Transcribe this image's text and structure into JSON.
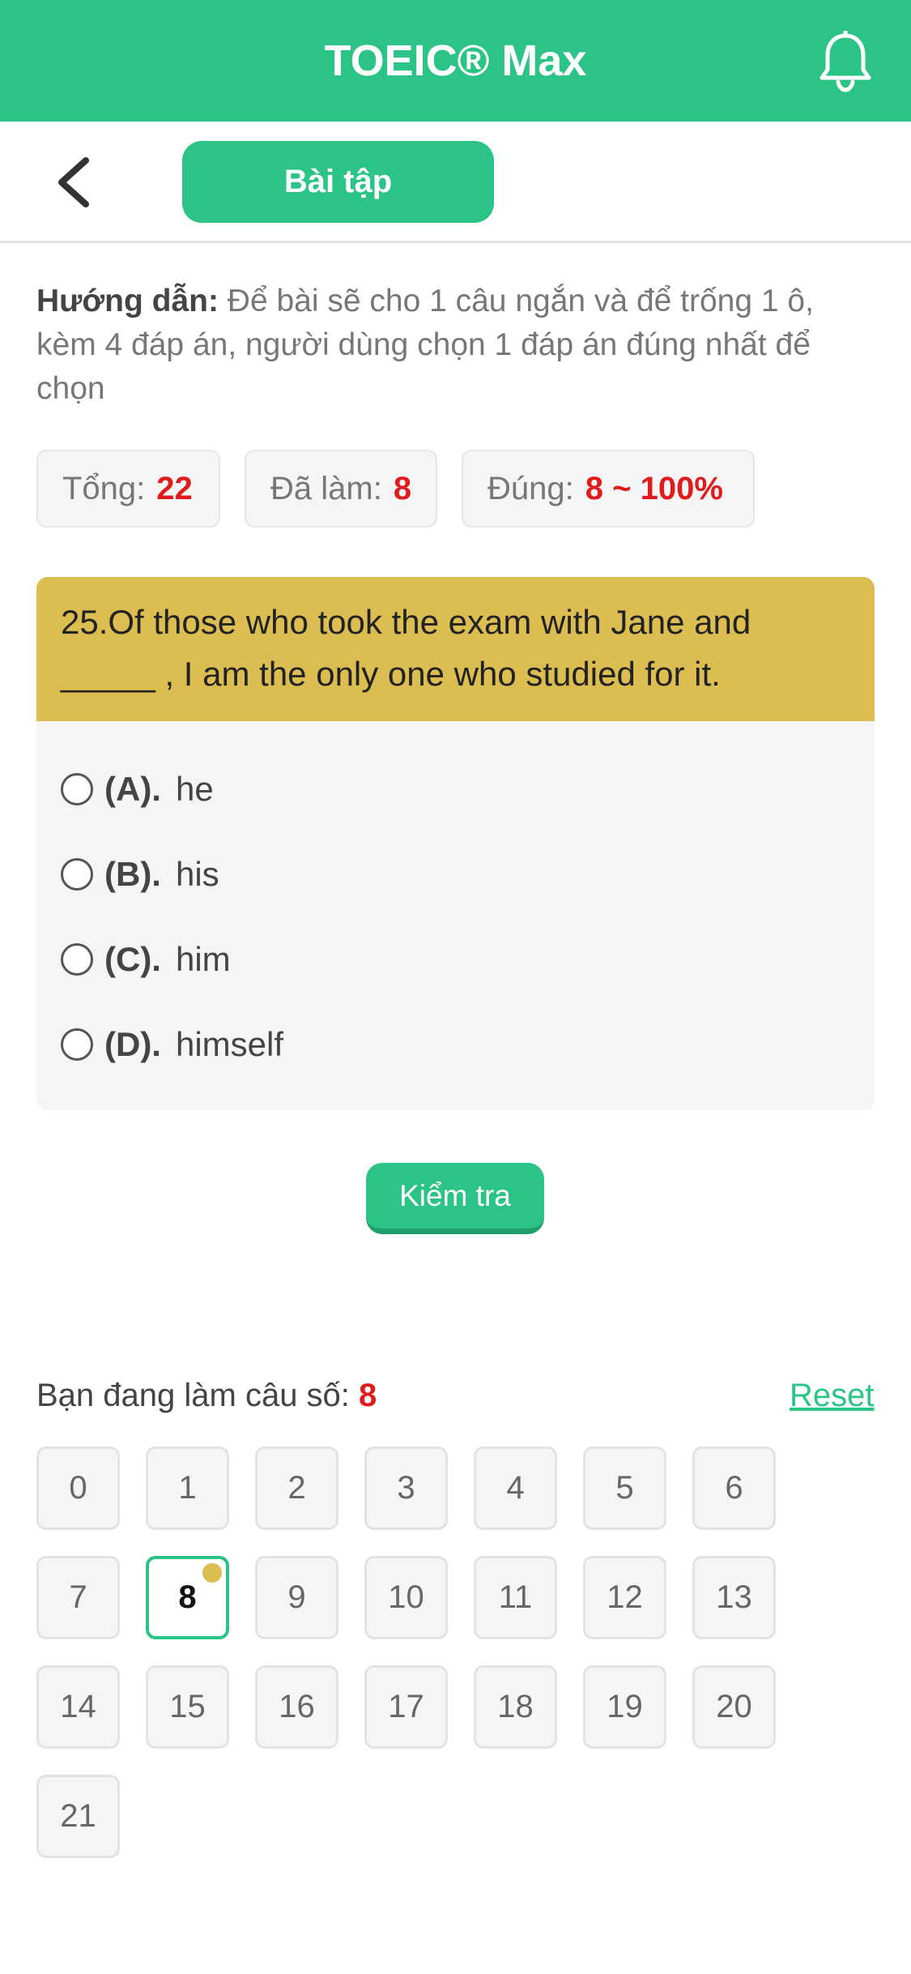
{
  "header": {
    "title": "TOEIC® Max"
  },
  "subbar": {
    "tab_label": "Bài tập"
  },
  "guide": {
    "label": "Hướng dẫn:",
    "text": "Để bài sẽ cho 1 câu ngắn và để trống 1 ô, kèm 4 đáp án, người dùng chọn 1 đáp án đúng nhất để chọn"
  },
  "stats": {
    "total_label": "Tổng:",
    "total_value": "22",
    "done_label": "Đã làm:",
    "done_value": "8",
    "correct_label": "Đúng:",
    "correct_value": "8 ~ 100%"
  },
  "question": {
    "line1": "25.Of those who took the exam with Jane and",
    "line2": "_____ , I am the only one who studied for it.",
    "options": [
      {
        "label": "(A).",
        "text": "he"
      },
      {
        "label": "(B).",
        "text": "his"
      },
      {
        "label": "(C).",
        "text": "him"
      },
      {
        "label": "(D).",
        "text": "himself"
      }
    ]
  },
  "check_button": "Kiểm tra",
  "progress": {
    "current_label": "Bạn đang làm câu số:",
    "current_value": "8",
    "reset_label": "Reset",
    "numbers": [
      "0",
      "1",
      "2",
      "3",
      "4",
      "5",
      "6",
      "7",
      "8",
      "9",
      "10",
      "11",
      "12",
      "13",
      "14",
      "15",
      "16",
      "17",
      "18",
      "19",
      "20",
      "21"
    ],
    "active": "8"
  },
  "colors": {
    "accent": "#2cc486",
    "question_bg": "#dbbd52",
    "highlight": "#e01b1b"
  },
  "icons": {
    "notification": "bell-icon",
    "back": "chevron-left-icon"
  }
}
